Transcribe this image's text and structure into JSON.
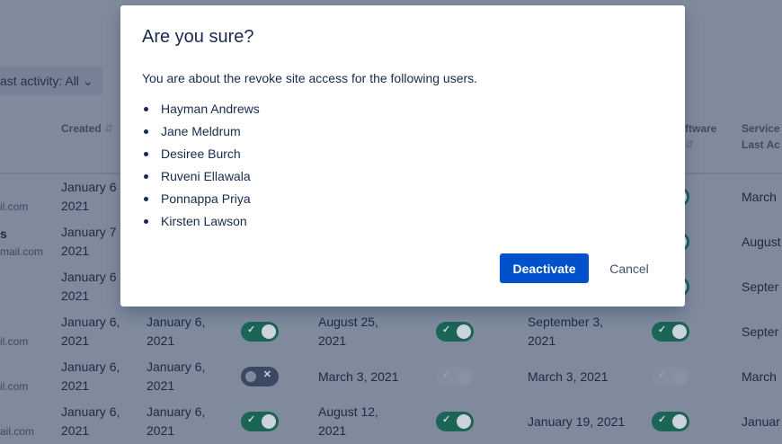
{
  "background": {
    "filter_label": "ast activity: All",
    "headers": [
      "Created",
      "Software",
      "Service",
      "Last Ac"
    ],
    "header_fragment_software": "ftware",
    "rows": [
      {
        "email": "il.com",
        "name": "",
        "created": [
          "January 6",
          "2021"
        ],
        "toggle1": null,
        "date1": null,
        "toggle2": null,
        "date2": null,
        "toggle3": "on",
        "service": "March"
      },
      {
        "email": "mail.com",
        "name": "s",
        "created": [
          "January 7",
          "2021"
        ],
        "toggle1": null,
        "date1": null,
        "toggle2": null,
        "date2": null,
        "toggle3": "on",
        "service": "August"
      },
      {
        "email": "",
        "name": "",
        "created": [
          "January 6",
          "2021"
        ],
        "toggle1": null,
        "date1": null,
        "toggle2": null,
        "date2": null,
        "toggle3": "on",
        "service": "Septer"
      },
      {
        "email": "il.com",
        "name": "",
        "created": [
          "January 6,",
          "2021"
        ],
        "col2": [
          "January 6,",
          "2021"
        ],
        "toggle1": "on",
        "date1": [
          "August 25,",
          "2021"
        ],
        "toggle2": "on",
        "date2": [
          "September 3,",
          "2021"
        ],
        "toggle3": "on",
        "service": "Septer"
      },
      {
        "email": "il.com",
        "name": "",
        "created": [
          "January 6,",
          "2021"
        ],
        "col2": [
          "January 6,",
          "2021"
        ],
        "toggle1": "off",
        "date1": [
          "March 3, 2021",
          ""
        ],
        "toggle2": "disabled",
        "date2": [
          "March 3, 2021",
          ""
        ],
        "toggle3": "disabled",
        "service": "March"
      },
      {
        "email": "ail.com",
        "name": "",
        "created": [
          "January 6,",
          "2021"
        ],
        "col2": [
          "January 6,",
          "2021"
        ],
        "toggle1": "on",
        "date1": [
          "August 12,",
          "2021"
        ],
        "toggle2": "on",
        "date2": [
          "January 19, 2021",
          ""
        ],
        "toggle3": "on",
        "service": "Januar"
      }
    ]
  },
  "modal": {
    "title": "Are you sure?",
    "message": "You are about the revoke site access for the following users.",
    "users": [
      "Hayman Andrews",
      "Jane Meldrum",
      "Desiree Burch",
      "Ruveni Ellawala",
      "Ponnappa Priya",
      "Kirsten Lawson"
    ],
    "confirm_label": "Deactivate",
    "cancel_label": "Cancel"
  },
  "colors": {
    "primary": "#0052cc",
    "toggle_on": "#00875a",
    "overlay": "#172b4d"
  }
}
